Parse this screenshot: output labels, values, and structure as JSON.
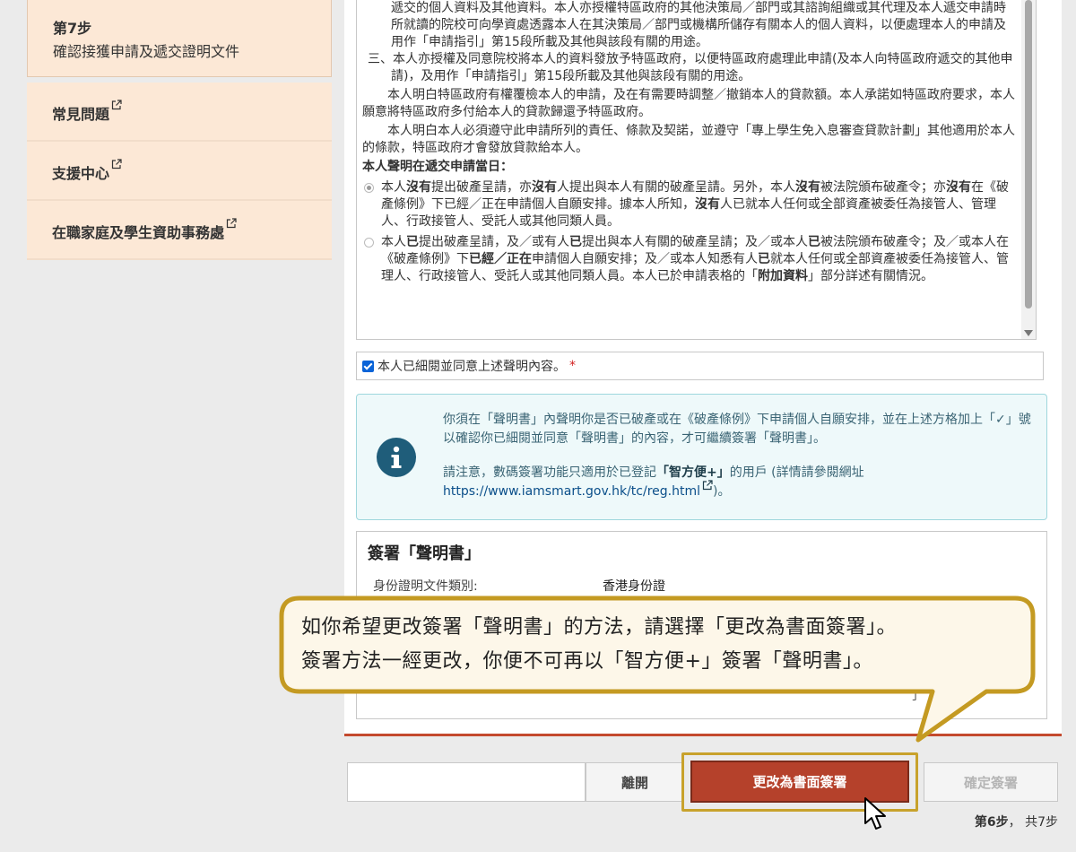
{
  "sidebar": {
    "step": {
      "number": "第7步",
      "text": "確認接獲申請及遞交證明文件"
    },
    "links": [
      {
        "label": "常見問題"
      },
      {
        "label": "支援中心"
      },
      {
        "label": "在職家庭及學生資助事務處"
      }
    ]
  },
  "declaration": {
    "line1": "遞交的個人資料及其他資料。本人亦授權特區政府的其他決策局／部門或其諮詢組織或其代理及本人遞交申請時所就讀的院校可向學資處透露本人在其決策局／部門或機構所儲存有關本人的個人資料，以便處理本人的申請及用作「申請指引」第15段所載及其他與該段有關的用途。",
    "item3": "三、本人亦授權及同意院校將本人的資料發放予特區政府，以便特區政府處理此申請(及本人向特區政府遞交的其他申請)，及用作「申請指引」第15段所載及其他與該段有關的用途。",
    "para1": "本人明白特區政府有權覆檢本人的申請，及在有需要時調整／撤銷本人的貸款額。本人承諾如特區政府要求，本人願意將特區政府多付給本人的貸款歸還予特區政府。",
    "para2": "本人明白本人必須遵守此申請所列的責任、條款及契諾，並遵守「專上學生免入息審查貸款計劃」其他適用於本人的條款，特區政府才會發放貸款給本人。",
    "heading": "本人聲明在遞交申請當日：",
    "option1": {
      "t1": "本人",
      "b1": "沒有",
      "t2": "提出破產呈請，亦",
      "b2": "沒有",
      "t3": "人提出與本人有關的破產呈請。另外，本人",
      "b3": "沒有",
      "t4": "被法院頒布破產令；亦",
      "b4": "沒有",
      "t5": "在《破產條例》下已經／正在申請個人自願安排。據本人所知，",
      "b5": "沒有",
      "t6": "人已就本人任何或全部資產被委任為接管人、管理人、行政接管人、受託人或其他同類人員。"
    },
    "option2": {
      "t1": "本人",
      "b1": "已",
      "t2": "提出破產呈請，及／或有人",
      "b2": "已",
      "t3": "提出與本人有關的破產呈請；及／或本人",
      "b3": "已",
      "t4": "被法院頒布破產令；及／或本人在《破產條例》下",
      "b4": "已經／正在",
      "t5": "申請個人自願安排；及／或本人知悉有人",
      "b5": "已",
      "t6": "就本人任何或全部資產被委任為接管人、管理人、行政接管人、受託人或其他同類人員。本人已於申請表格的「",
      "b6": "附加資料",
      "t7": "」部分詳述有關情況。"
    }
  },
  "agree": {
    "label": "本人已細閱並同意上述聲明內容。",
    "required": "*"
  },
  "info": {
    "p1": "你須在「聲明書」內聲明你是否已破產或在《破產條例》下申請個人自願安排，並在上述方格加上「✓」號以確認你已細閱並同意「聲明書」的內容，才可繼續簽署「聲明書」。",
    "p2_a": "請注意，數碼簽署功能只適用於已登記",
    "p2_b": "「智方便+」",
    "p2_c": "的用戶 (詳情請參閱網址",
    "link": "https://www.iamsmart.gov.hk/tc/reg.html",
    "p2_d": ")。"
  },
  "sign": {
    "title": "簽署「聲明書」",
    "id_label": "身份證明文件類別:",
    "id_value": "香港身份證",
    "fragment": "了"
  },
  "tooltip": {
    "line1": "如你希望更改簽署「聲明書」的方法，請選擇「更改為書面簽署」。",
    "line2": "簽署方法一經更改，你便不可再以「智方便+」簽署「聲明書」。"
  },
  "buttons": {
    "leave": "離開",
    "change": "更改為書面簽署",
    "confirm": "確定簽署"
  },
  "progress": {
    "current": "第6步",
    "sep": "，",
    "total": "共7步"
  },
  "colors": {
    "primary": "#b5412b",
    "highlight": "#c8a22c",
    "info_icon": "#1f5d7a",
    "sidebar_bg": "#fce8d6"
  }
}
